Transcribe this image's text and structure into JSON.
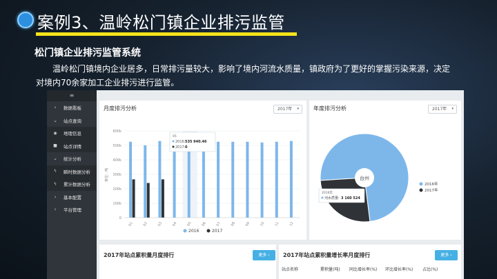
{
  "header": {
    "title": "案例3、温岭松门镇企业排污监管",
    "subtitle": "松门镇企业排污监管系统",
    "paragraph": "温岭松门镇境内企业居多，日常排污量较大，影响了境内河流水质量，镇政府为了更好的掌握污染来源，决定对境内70余家加工企业排污进行监管。"
  },
  "colors": {
    "accent_yellow": "#f5e31a",
    "series_2016": "#7db7ea",
    "series_2017": "#2f3337",
    "button_blue": "#45b0e4"
  },
  "sidebar": {
    "menu_icon": "≡",
    "items": [
      {
        "icon": "chevron-right-icon",
        "glyph": "›",
        "label": "数据看板",
        "sub": false
      },
      {
        "icon": "chevron-down-icon",
        "glyph": "⌄",
        "label": "站点查询",
        "sub": false
      },
      {
        "icon": "globe-icon",
        "glyph": "◉",
        "label": "地理信息",
        "sub": true
      },
      {
        "icon": "square-icon",
        "glyph": "■",
        "label": "站点详情",
        "sub": true
      },
      {
        "icon": "chevron-down-icon",
        "glyph": "⌄",
        "label": "统计分析",
        "sub": false
      },
      {
        "icon": "bolt-icon",
        "glyph": "ϟ",
        "label": "瞬时数据分析",
        "sub": true
      },
      {
        "icon": "bolt-icon",
        "glyph": "ϟ",
        "label": "累计数据分析",
        "sub": true
      },
      {
        "icon": "chevron-right-icon",
        "glyph": "›",
        "label": "基本配置",
        "sub": false
      },
      {
        "icon": "chevron-right-icon",
        "glyph": "›",
        "label": "平台管理",
        "sub": false
      }
    ]
  },
  "monthly_panel": {
    "title": "月度排污分析",
    "year_select": "2017年",
    "tooltip": {
      "header": "05",
      "line1_label": "2016:",
      "line1_value": "535 940.46",
      "line2_label": "2017:",
      "line2_value": "0"
    }
  },
  "annual_panel": {
    "title": "年度排污分析",
    "year_select": "2017年",
    "center_label": "台州",
    "tooltip": {
      "header": "2016年",
      "label": "河水质量:",
      "value": "3 160 524"
    }
  },
  "ranking_panel": {
    "title": "2017年站点累积量月度排行",
    "more_label": "更多 ›"
  },
  "growth_panel": {
    "title": "2017年站点累积量增长率月度排行",
    "more_label": "更多 ›",
    "columns": [
      "站点名称",
      "累积量(吨)",
      "同比增长率(%)",
      "环比增长率(%)",
      "占比(%)"
    ]
  },
  "chart_data": [
    {
      "type": "bar",
      "title": "月度排污分析",
      "xlabel": "",
      "ylabel": "单位：吨",
      "ylim": [
        0,
        600000
      ],
      "yticks": [
        "0",
        "100k",
        "200k",
        "300k",
        "400k",
        "500k",
        "600k"
      ],
      "categories": [
        "01",
        "02",
        "03",
        "04",
        "05",
        "06",
        "07",
        "08",
        "09",
        "10",
        "11",
        "12"
      ],
      "series": [
        {
          "name": "2016",
          "color": "#7db7ea",
          "values": [
            525000,
            500000,
            530000,
            525000,
            535940.46,
            530000,
            525000,
            525000,
            525000,
            520000,
            525000,
            530000
          ]
        },
        {
          "name": "2017",
          "color": "#2f3337",
          "values": [
            265000,
            240000,
            265000,
            0,
            0,
            0,
            0,
            0,
            0,
            0,
            0,
            0
          ]
        }
      ],
      "legend": "bottom",
      "grid": true
    },
    {
      "type": "pie",
      "title": "年度排污分析",
      "slices": [
        {
          "name": "2016年",
          "value": 3160524,
          "color": "#7db7ea"
        },
        {
          "name": "2017年",
          "value": 1110000,
          "color": "#2f3337"
        }
      ],
      "legend": "right"
    }
  ]
}
